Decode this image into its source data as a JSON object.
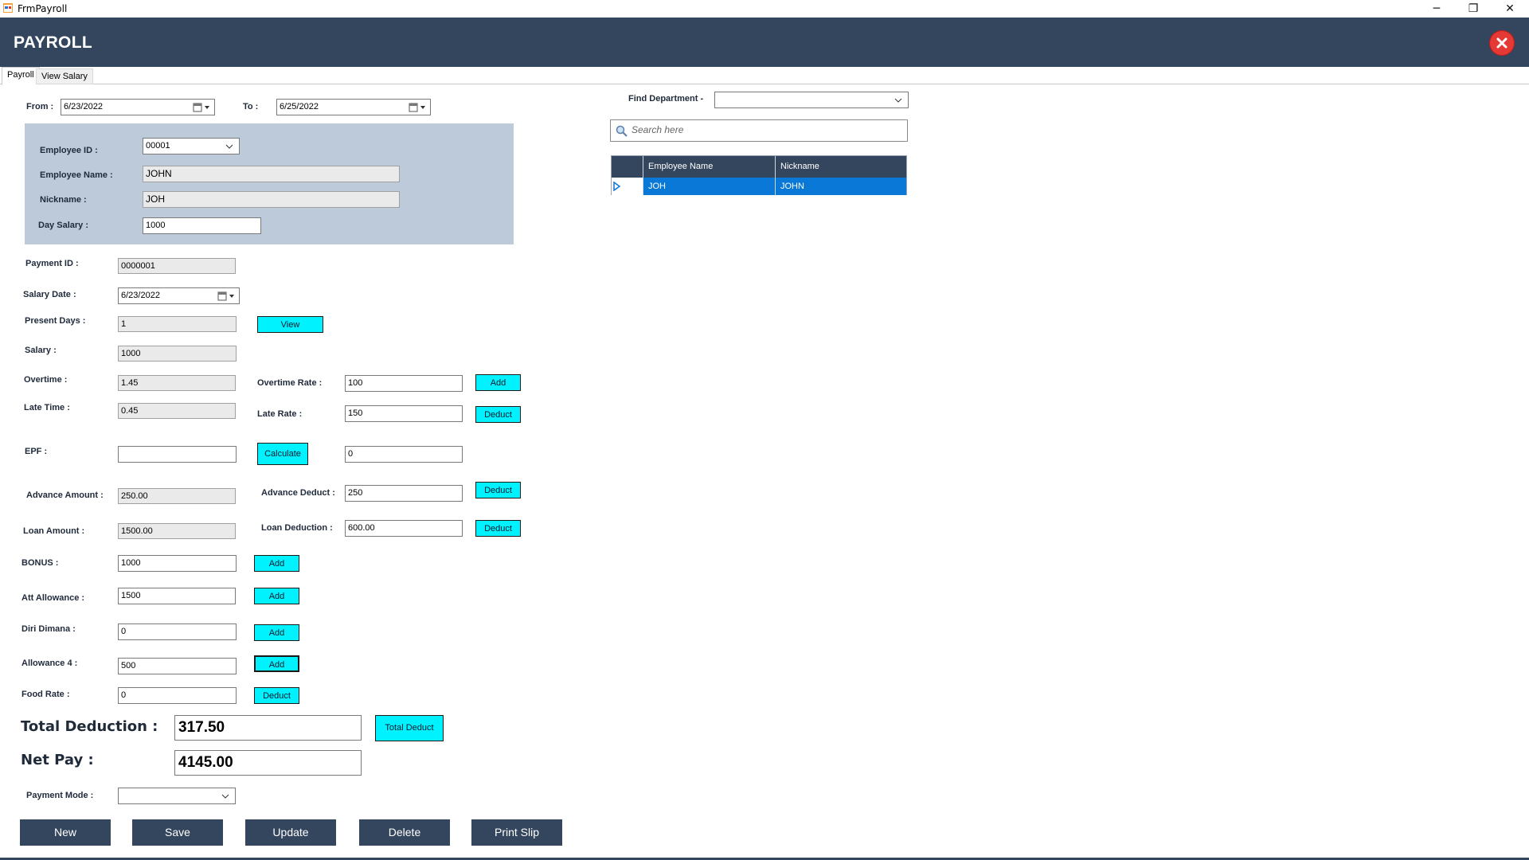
{
  "window": {
    "title": "FrmPayroll",
    "min_glyph": "─",
    "restore_glyph": "❐",
    "close_glyph": "✕"
  },
  "header": {
    "title": "PAYROLL",
    "close_icon": "close-circle-icon"
  },
  "tabs": [
    {
      "label": "Payroll",
      "active": true
    },
    {
      "label": "View Salary",
      "active": false
    }
  ],
  "date_range": {
    "from_label": "From :",
    "from_value": "6/23/2022",
    "to_label": "To :",
    "to_value": "6/25/2022"
  },
  "employee": {
    "id_label": "Employee ID :",
    "id_value": "00001",
    "name_label": "Employee Name :",
    "name_value": "JOHN",
    "nickname_label": "Nickname :",
    "nickname_value": "JOH",
    "day_salary_label": "Day Salary :",
    "day_salary_value": "1000"
  },
  "payment": {
    "id_label": "Payment ID :",
    "id_value": "0000001",
    "salary_date_label": "Salary Date :",
    "salary_date_value": "6/23/2022",
    "present_days_label": "Present Days :",
    "present_days_value": "1",
    "view_button": "View",
    "salary_label": "Salary :",
    "salary_value": "1000",
    "overtime_label": "Overtime :",
    "overtime_value": "1.45",
    "overtime_rate_label": "Overtime Rate :",
    "overtime_rate_value": "100",
    "overtime_add": "Add",
    "late_time_label": "Late Time :",
    "late_time_value": "0.45",
    "late_rate_label": "Late Rate :",
    "late_rate_value": "150",
    "late_deduct": "Deduct",
    "epf_label": "EPF :",
    "epf_value": "",
    "calculate_button": "Calculate",
    "epf_result": "0",
    "advance_amount_label": "Advance Amount :",
    "advance_amount_value": "250.00",
    "advance_deduct_label": "Advance Deduct :",
    "advance_deduct_value": "250",
    "advance_deduct_button": "Deduct",
    "loan_amount_label": "Loan Amount :",
    "loan_amount_value": "1500.00",
    "loan_deduction_label": "Loan Deduction :",
    "loan_deduction_value": "600.00",
    "loan_deduct_button": "Deduct",
    "bonus_label": "BONUS :",
    "bonus_value": "1000",
    "bonus_add": "Add",
    "att_allowance_label": "Att Allowance :",
    "att_allowance_value": "1500",
    "att_add": "Add",
    "diri_dimana_label": "Diri Dimana :",
    "diri_dimana_value": "0",
    "diri_add": "Add",
    "allowance4_label": "Allowance 4 :",
    "allowance4_value": "500",
    "allowance4_add": "Add",
    "food_rate_label": "Food Rate :",
    "food_rate_value": "0",
    "food_deduct": "Deduct",
    "total_deduction_label": "Total Deduction :",
    "total_deduction_value": "317.50",
    "total_deduct_button": "Total Deduct",
    "net_pay_label": "Net Pay :",
    "net_pay_value": "4145.00",
    "payment_mode_label": "Payment Mode :",
    "payment_mode_value": ""
  },
  "actions": {
    "new": "New",
    "save": "Save",
    "update": "Update",
    "delete": "Delete",
    "print": "Print Slip"
  },
  "search": {
    "find_department_label": "Find Department -",
    "find_department_value": "",
    "placeholder": "Search here",
    "columns": [
      "Employee Name",
      "Nickname"
    ],
    "rows": [
      {
        "employee_name": "JOH",
        "nickname": "JOHN"
      }
    ]
  },
  "colors": {
    "header": "#34465e",
    "panel": "#bccada",
    "cyan_button": "#00f2ff",
    "selected_row": "#0a78d6",
    "close": "#e53935"
  }
}
